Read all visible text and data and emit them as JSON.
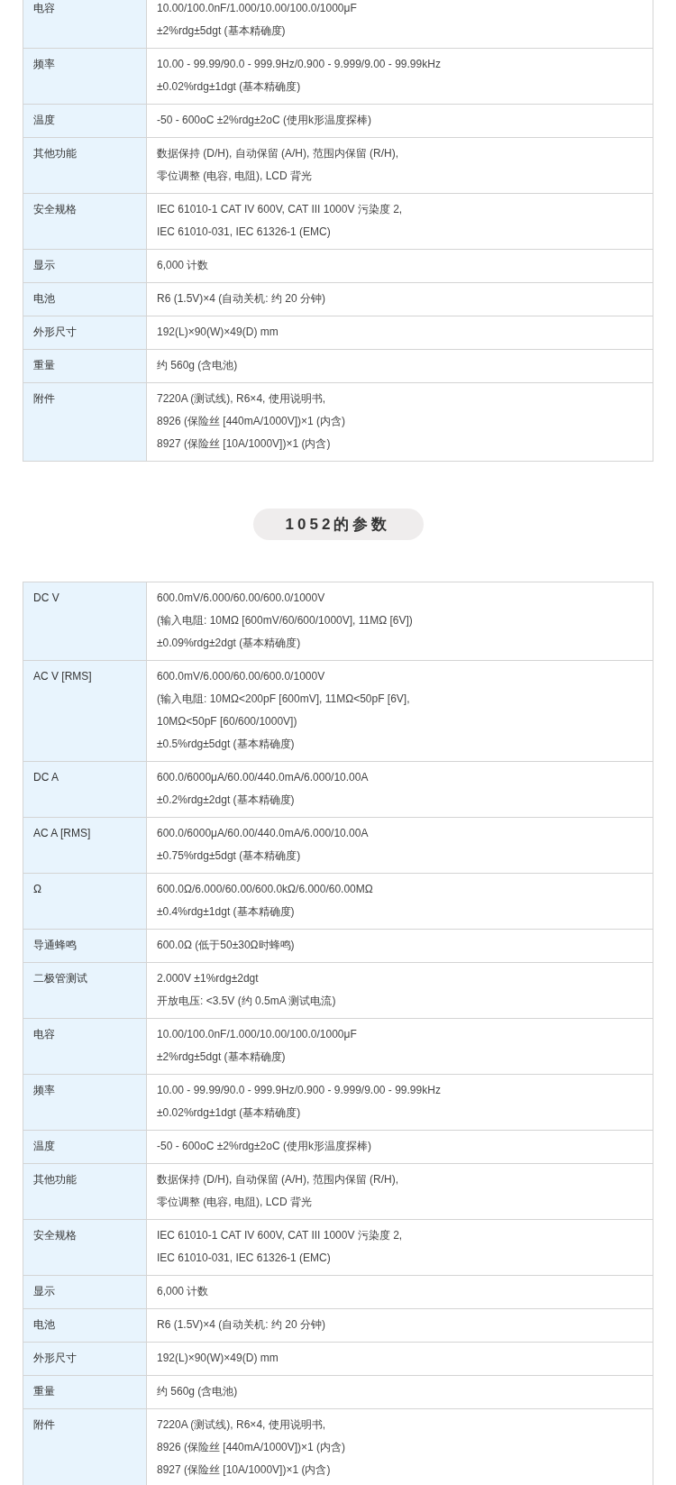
{
  "tables": [
    {
      "rows": [
        {
          "label": "电容",
          "lines": [
            "10.00/100.0nF/1.000/10.00/100.0/1000μF",
            "±2%rdg±5dgt (基本精确度)"
          ]
        },
        {
          "label": "频率",
          "lines": [
            "10.00 - 99.99/90.0 - 999.9Hz/0.900 - 9.999/9.00 - 99.99kHz",
            "±0.02%rdg±1dgt (基本精确度)"
          ]
        },
        {
          "label": "温度",
          "lines": [
            "-50 - 600oC ±2%rdg±2oC (使用k形温度探棒)"
          ]
        },
        {
          "label": "其他功能",
          "lines": [
            "数据保持 (D/H), 自动保留 (A/H), 范围内保留 (R/H),",
            "零位调整 (电容, 电阻), LCD 背光"
          ]
        },
        {
          "label": "安全规格",
          "lines": [
            "IEC 61010-1 CAT IV 600V, CAT III 1000V 污染度 2,",
            "IEC 61010-031, IEC 61326-1 (EMC)"
          ]
        },
        {
          "label": "显示",
          "lines": [
            "6,000 计数"
          ]
        },
        {
          "label": "电池",
          "lines": [
            "R6 (1.5V)×4 (自动关机: 约 20 分钟)"
          ]
        },
        {
          "label": "外形尺寸",
          "lines": [
            "192(L)×90(W)×49(D) mm"
          ]
        },
        {
          "label": "重量",
          "lines": [
            "约 560g (含电池)"
          ]
        },
        {
          "label": "附件",
          "lines": [
            "7220A (测试线), R6×4, 使用说明书,",
            "8926 (保险丝 [440mA/1000V])×1 (内含)",
            "8927 (保险丝 [10A/1000V])×1 (内含)"
          ]
        }
      ]
    },
    {
      "heading": "1052的参数",
      "rows": [
        {
          "label": "DC V",
          "lines": [
            "600.0mV/6.000/60.00/600.0/1000V",
            "(输入电阻: 10MΩ [600mV/60/600/1000V], 11MΩ [6V])",
            "±0.09%rdg±2dgt (基本精确度)"
          ]
        },
        {
          "label": "AC V [RMS]",
          "lines": [
            "600.0mV/6.000/60.00/600.0/1000V",
            "(输入电阻: 10MΩ<200pF [600mV], 11MΩ<50pF [6V],",
            "10MΩ<50pF [60/600/1000V])",
            "±0.5%rdg±5dgt (基本精确度)"
          ]
        },
        {
          "label": "DC A",
          "lines": [
            "600.0/6000μA/60.00/440.0mA/6.000/10.00A",
            "±0.2%rdg±2dgt (基本精确度)"
          ]
        },
        {
          "label": "AC A [RMS]",
          "lines": [
            "600.0/6000μA/60.00/440.0mA/6.000/10.00A",
            "±0.75%rdg±5dgt (基本精确度)"
          ]
        },
        {
          "label": "Ω",
          "lines": [
            "600.0Ω/6.000/60.00/600.0kΩ/6.000/60.00MΩ",
            "±0.4%rdg±1dgt (基本精确度)"
          ]
        },
        {
          "label": "导通蜂鸣",
          "lines": [
            "600.0Ω (低于50±30Ω时蜂鸣)"
          ]
        },
        {
          "label": "二极管测试",
          "lines": [
            "2.000V ±1%rdg±2dgt",
            "开放电压: <3.5V (约 0.5mA 测试电流)"
          ]
        },
        {
          "label": "电容",
          "lines": [
            "10.00/100.0nF/1.000/10.00/100.0/1000μF",
            "±2%rdg±5dgt (基本精确度)"
          ]
        },
        {
          "label": "频率",
          "lines": [
            "10.00 - 99.99/90.0 - 999.9Hz/0.900 - 9.999/9.00 - 99.99kHz",
            "±0.02%rdg±1dgt (基本精确度)"
          ]
        },
        {
          "label": "温度",
          "lines": [
            "-50 - 600oC ±2%rdg±2oC (使用k形温度探棒)"
          ]
        },
        {
          "label": "其他功能",
          "lines": [
            "数据保持 (D/H), 自动保留 (A/H), 范围内保留 (R/H),",
            "零位调整 (电容, 电阻), LCD 背光"
          ]
        },
        {
          "label": "安全规格",
          "lines": [
            "IEC 61010-1 CAT IV 600V, CAT III 1000V 污染度 2,",
            "IEC 61010-031, IEC 61326-1 (EMC)"
          ]
        },
        {
          "label": "显示",
          "lines": [
            "6,000 计数"
          ]
        },
        {
          "label": "电池",
          "lines": [
            "R6 (1.5V)×4 (自动关机: 约 20 分钟)"
          ]
        },
        {
          "label": "外形尺寸",
          "lines": [
            "192(L)×90(W)×49(D) mm"
          ]
        },
        {
          "label": "重量",
          "lines": [
            "约 560g (含电池)"
          ]
        },
        {
          "label": "附件",
          "lines": [
            "7220A (测试线), R6×4, 使用说明书,",
            "8926 (保险丝 [440mA/1000V])×1 (内含)",
            "8927 (保险丝 [10A/1000V])×1 (内含)"
          ]
        }
      ]
    }
  ]
}
